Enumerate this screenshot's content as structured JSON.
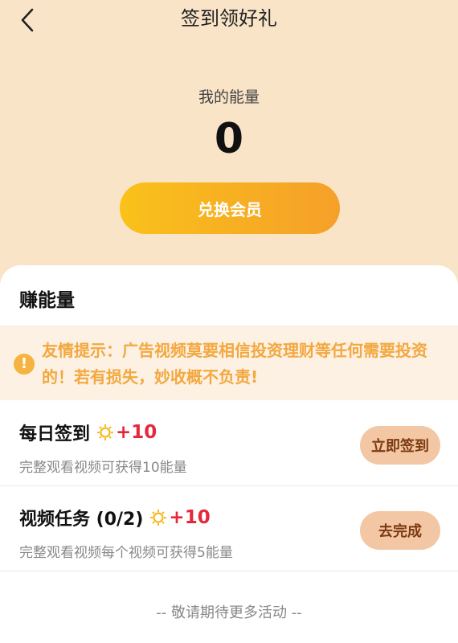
{
  "header": {
    "title": "签到领好礼",
    "back_icon": "chevron-left-icon"
  },
  "energy": {
    "label": "我的能量",
    "value": "0"
  },
  "redeem_button": "兑换会员",
  "earn_section": {
    "title": "赚能量",
    "notice": "友情提示：广告视频莫要相信投资理财等任何需要投资的！若有损失，妙收概不负责!",
    "notice_icon": "!"
  },
  "tasks": [
    {
      "name": "每日签到",
      "points": "+10",
      "desc": "完整观看视频可获得10能量",
      "button": "立即签到"
    },
    {
      "name": "视频任务 (0/2)",
      "points": "+10",
      "desc": "完整观看视频每个视频可获得5能量",
      "button": "去完成"
    }
  ],
  "footer_text": "-- 敬请期待更多活动 --",
  "colors": {
    "accent": "#f7ae22",
    "points": "#e5283c",
    "notice": "#f3a83f",
    "bg": "#f9e4c8"
  }
}
